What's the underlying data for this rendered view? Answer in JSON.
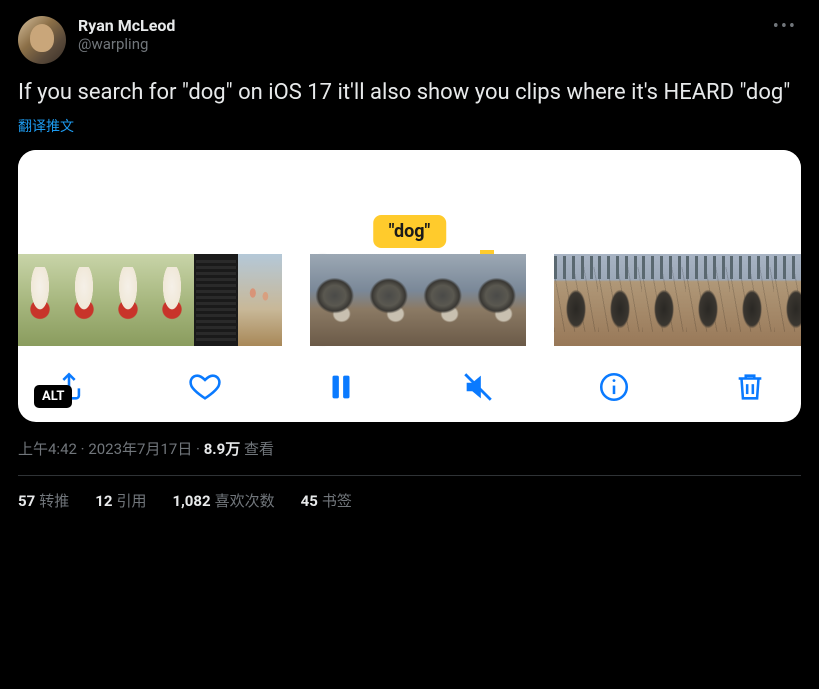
{
  "user": {
    "display_name": "Ryan McLeod",
    "handle": "@warpling"
  },
  "tweet_text": "If you search for \"dog\" on iOS 17 it'll also show you clips where it's HEARD \"dog\"",
  "translate_link": "翻译推文",
  "media": {
    "search_badge": "\"dog\"",
    "alt_badge": "ALT"
  },
  "meta": {
    "time": "上午4:42",
    "separator": " · ",
    "date": "2023年7月17日",
    "views_count": "8.9万",
    "views_label": " 查看"
  },
  "stats": {
    "retweets_count": "57",
    "retweets_label": "转推",
    "quotes_count": "12",
    "quotes_label": "引用",
    "likes_count": "1,082",
    "likes_label": "喜欢次数",
    "bookmarks_count": "45",
    "bookmarks_label": "书签"
  }
}
